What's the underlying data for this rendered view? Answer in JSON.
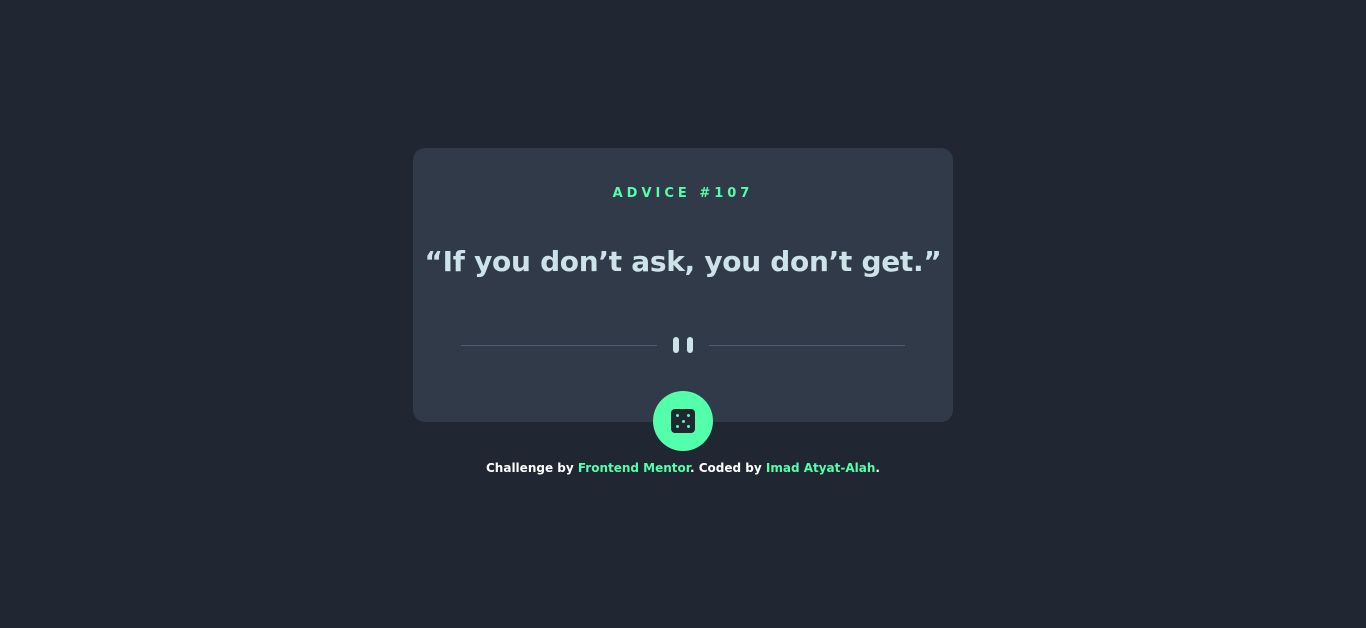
{
  "card": {
    "advice_label": "ADVICE #107",
    "quote": "“If you don’t ask, you don’t get.”"
  },
  "icons": {
    "divider": "pause-icon",
    "generate": "dice-icon"
  },
  "footer": {
    "prefix": "Challenge by ",
    "challenge_link": "Frontend Mentor",
    "middle": ". Coded by ",
    "author_link": "Imad Atyat-Alah",
    "suffix": "."
  },
  "colors": {
    "background": "#202632",
    "card": "#313A48",
    "accent": "#53FFAA",
    "quote_text": "#CEE3E9",
    "divider_line": "#4F5D74"
  }
}
